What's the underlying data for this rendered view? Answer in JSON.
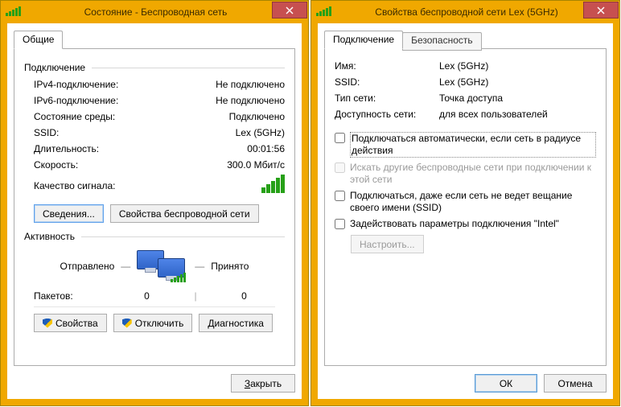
{
  "left": {
    "title": "Состояние - Беспроводная сеть",
    "tab_general": "Общие",
    "group_conn": "Подключение",
    "rows": {
      "ipv4_k": "IPv4-подключение:",
      "ipv4_v": "Не подключено",
      "ipv6_k": "IPv6-подключение:",
      "ipv6_v": "Не подключено",
      "media_k": "Состояние среды:",
      "media_v": "Подключено",
      "ssid_k": "SSID:",
      "ssid_v": "Lex (5GHz)",
      "dur_k": "Длительность:",
      "dur_v": "00:01:56",
      "speed_k": "Скорость:",
      "speed_v": "300.0 Мбит/с",
      "quality_k": "Качество сигнала:"
    },
    "btn_details": "Сведения...",
    "btn_wprops": "Свойства беспроводной сети",
    "group_activity": "Активность",
    "act_sent": "Отправлено",
    "act_recv": "Принято",
    "packets_k": "Пакетов:",
    "packets_sent": "0",
    "packets_recv": "0",
    "btn_props": "Свойства",
    "btn_disconnect": "Отключить",
    "btn_diag": "Диагностика",
    "btn_close": "Закрыть"
  },
  "right": {
    "title": "Свойства беспроводной сети Lex (5GHz)",
    "tab_conn": "Подключение",
    "tab_sec": "Безопасность",
    "props": {
      "name_k": "Имя:",
      "name_v": "Lex (5GHz)",
      "ssid_k": "SSID:",
      "ssid_v": "Lex (5GHz)",
      "type_k": "Тип сети:",
      "type_v": "Точка доступа",
      "avail_k": "Доступность сети:",
      "avail_v": "для всех пользователей"
    },
    "chk_auto": "Подключаться автоматически, если сеть в радиусе действия",
    "chk_other": "Искать другие беспроводные сети при подключении к этой сети",
    "chk_hidden": "Подключаться, даже если сеть не ведет вещание своего имени (SSID)",
    "chk_intel": "Задействовать параметры подключения \"Intel\"",
    "btn_configure": "Настроить...",
    "btn_ok": "ОК",
    "btn_cancel": "Отмена"
  }
}
